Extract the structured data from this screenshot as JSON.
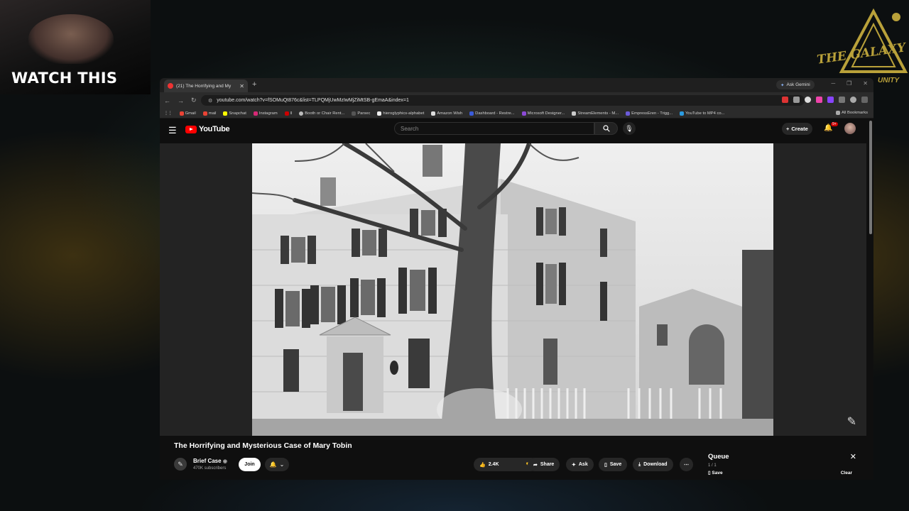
{
  "overlay": {
    "webcam_caption": "WATCH THIS",
    "logo_text": "THE GALAXY",
    "logo_sub": "UNITY"
  },
  "browser": {
    "tab_title": "(21) The Horrifying and My",
    "url": "youtube.com/watch?v=fSOMuQt876c&list=TLPQMjUwMzIwMjZiMtSB-gEmaA&index=1",
    "ask_gemini": "Ask Gemini",
    "bookmarks": [
      "Gmail",
      "mail",
      "Snapchat",
      "Instagram",
      "ll",
      "Booth or Chair Rent...",
      "Parsec",
      "hieroglyphics-alphabet",
      "Amazon Wish",
      "Dashboard - Restre...",
      "Microsoft Designer...",
      "StreamElements - M...",
      "EmpressEren - Trigg...",
      "YouTube to MP4 co..."
    ],
    "all_bookmarks": "All Bookmarks"
  },
  "youtube": {
    "logo": "YouTube",
    "search_placeholder": "Search",
    "create_label": "Create",
    "notif_badge": "9+",
    "video": {
      "title": "The Horrifying and Mysterious Case of Mary Tobin",
      "channel": "Brief Case",
      "subscribers": "470K subscribers",
      "join": "Join",
      "likes": "2.4K",
      "share": "Share",
      "ask": "Ask",
      "save": "Save",
      "download": "Download"
    },
    "queue": {
      "title": "Queue",
      "count": "1 / 1",
      "save": "Save",
      "clear": "Clear"
    }
  }
}
